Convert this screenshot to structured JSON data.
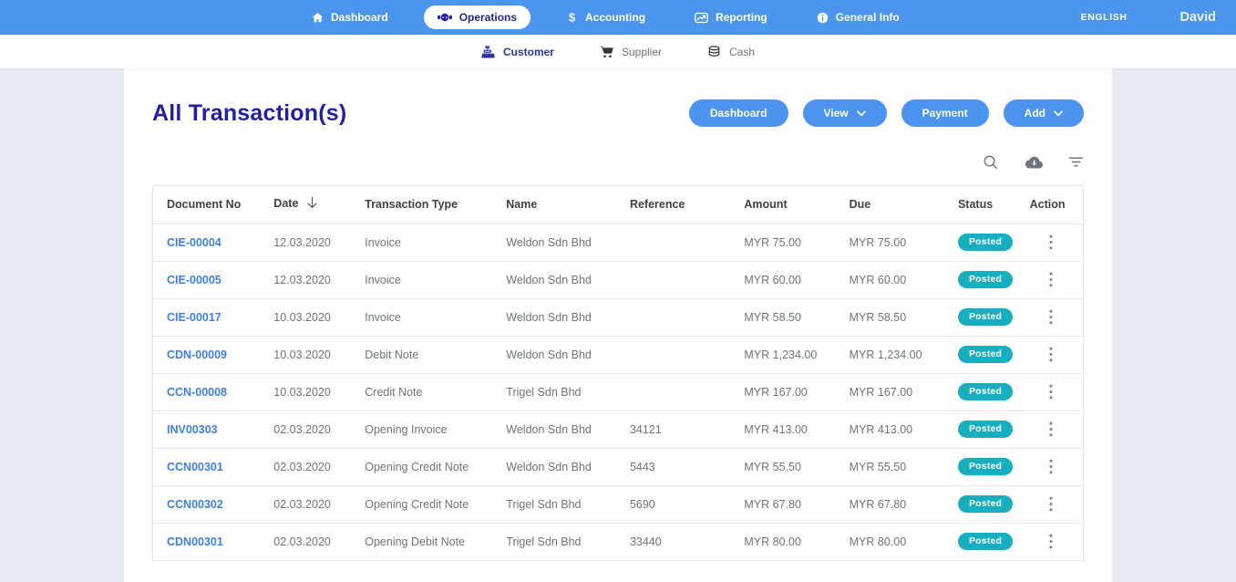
{
  "topnav": {
    "items": [
      {
        "label": "Dashboard",
        "icon": "home-icon",
        "active": false
      },
      {
        "label": "Operations",
        "icon": "operations-icon",
        "active": true
      },
      {
        "label": "Accounting",
        "icon": "dollar-icon",
        "active": false
      },
      {
        "label": "Reporting",
        "icon": "chart-icon",
        "active": false
      },
      {
        "label": "General Info",
        "icon": "info-icon",
        "active": false
      }
    ],
    "language": "ENGLISH",
    "language_dropdown_icon": "chevron-down-icon",
    "help_icon": "help-icon",
    "account_icon": "user-icon",
    "user_name": "David"
  },
  "subnav": {
    "items": [
      {
        "label": "Customer",
        "icon": "cash-register-icon",
        "active": true
      },
      {
        "label": "Supplier",
        "icon": "cart-icon",
        "active": false
      },
      {
        "label": "Cash",
        "icon": "coins-icon",
        "active": false
      }
    ]
  },
  "header": {
    "title": "All Transaction(s)",
    "buttons": [
      {
        "label": "Dashboard",
        "dropdown": false
      },
      {
        "label": "View",
        "dropdown": true
      },
      {
        "label": "Payment",
        "dropdown": false
      },
      {
        "label": "Add",
        "dropdown": true
      }
    ]
  },
  "toolbar": {
    "icons": [
      "search-icon",
      "cloud-download-icon",
      "filter-icon"
    ]
  },
  "table": {
    "columns": [
      {
        "key": "document_no",
        "label": "Document No"
      },
      {
        "key": "date",
        "label": "Date",
        "sorted": "desc"
      },
      {
        "key": "transaction_type",
        "label": "Transaction Type"
      },
      {
        "key": "name",
        "label": "Name"
      },
      {
        "key": "reference",
        "label": "Reference"
      },
      {
        "key": "amount",
        "label": "Amount"
      },
      {
        "key": "due",
        "label": "Due"
      },
      {
        "key": "status",
        "label": "Status"
      },
      {
        "key": "action",
        "label": "Action"
      }
    ],
    "rows": [
      {
        "document_no": "CIE-00004",
        "date": "12.03.2020",
        "transaction_type": "Invoice",
        "name": "Weldon Sdn Bhd",
        "reference": "",
        "amount": "MYR 75.00",
        "due": "MYR 75.00",
        "status": "Posted"
      },
      {
        "document_no": "CIE-00005",
        "date": "12.03.2020",
        "transaction_type": "Invoice",
        "name": "Weldon Sdn Bhd",
        "reference": "",
        "amount": "MYR 60.00",
        "due": "MYR 60.00",
        "status": "Posted"
      },
      {
        "document_no": "CIE-00017",
        "date": "10.03.2020",
        "transaction_type": "Invoice",
        "name": "Weldon Sdn Bhd",
        "reference": "",
        "amount": "MYR 58.50",
        "due": "MYR 58.50",
        "status": "Posted"
      },
      {
        "document_no": "CDN-00009",
        "date": "10.03.2020",
        "transaction_type": "Debit Note",
        "name": "Weldon Sdn Bhd",
        "reference": "",
        "amount": "MYR 1,234.00",
        "due": "MYR 1,234.00",
        "status": "Posted"
      },
      {
        "document_no": "CCN-00008",
        "date": "10.03.2020",
        "transaction_type": "Credit Note",
        "name": "Trigel Sdn Bhd",
        "reference": "",
        "amount": "MYR 167.00",
        "due": "MYR 167.00",
        "status": "Posted"
      },
      {
        "document_no": "INV00303",
        "date": "02.03.2020",
        "transaction_type": "Opening Invoice",
        "name": "Weldon Sdn Bhd",
        "reference": "34121",
        "amount": "MYR 413.00",
        "due": "MYR 413.00",
        "status": "Posted"
      },
      {
        "document_no": "CCN00301",
        "date": "02.03.2020",
        "transaction_type": "Opening Credit Note",
        "name": "Weldon Sdn Bhd",
        "reference": "5443",
        "amount": "MYR 55.50",
        "due": "MYR 55.50",
        "status": "Posted"
      },
      {
        "document_no": "CCN00302",
        "date": "02.03.2020",
        "transaction_type": "Opening Credit Note",
        "name": "Trigel Sdn Bhd",
        "reference": "5690",
        "amount": "MYR 67.80",
        "due": "MYR 67.80",
        "status": "Posted"
      },
      {
        "document_no": "CDN00301",
        "date": "02.03.2020",
        "transaction_type": "Opening Debit Note",
        "name": "Trigel Sdn Bhd",
        "reference": "33440",
        "amount": "MYR 80.00",
        "due": "MYR 80.00",
        "status": "Posted"
      }
    ],
    "row_action_icon": "kebab-menu-icon",
    "status_badge_color": "#17aebf"
  },
  "colors": {
    "topbar_blue": "#4c95ef",
    "button_blue": "#4c94f0",
    "title_navy": "#211fa4",
    "link_blue": "#3d7ee8",
    "active_nav_text": "#26269c",
    "subnav_active": "#2b35a8",
    "badge_teal": "#17aebf",
    "page_background": "#e6ebf2"
  }
}
